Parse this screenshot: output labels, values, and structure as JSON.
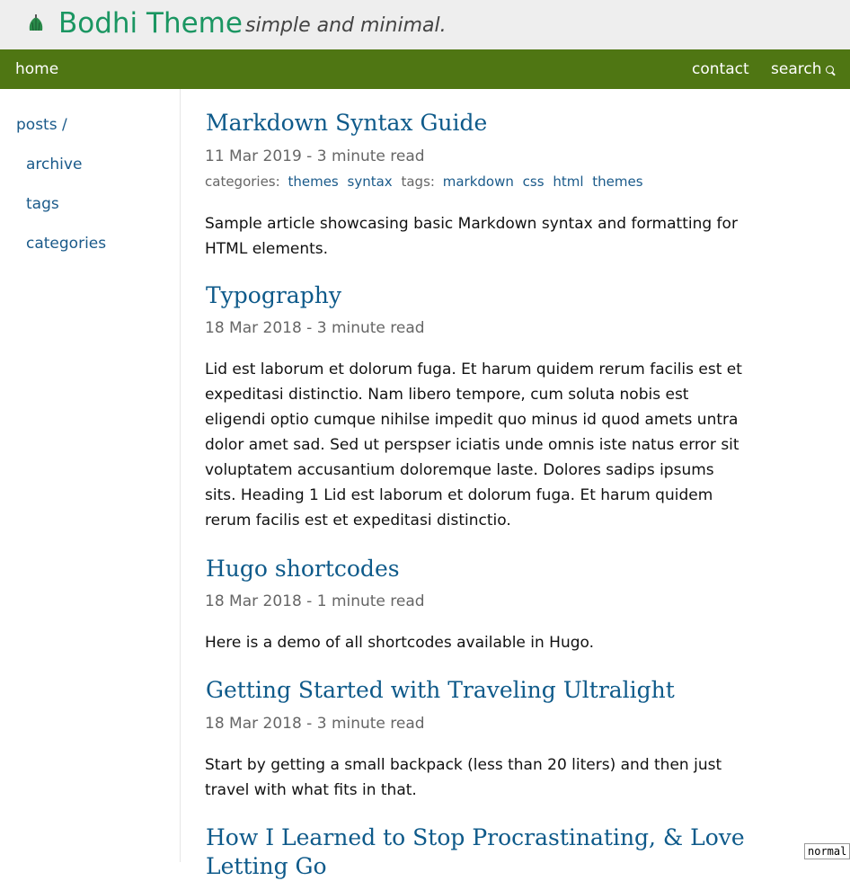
{
  "header": {
    "title": "Bodhi Theme",
    "tagline": "simple and minimal.",
    "logo_icon": "leaf-icon",
    "title_color": "#1b9662"
  },
  "nav": {
    "home": "home",
    "contact": "contact",
    "search": "search",
    "bar_color": "#4f7613"
  },
  "sidebar": {
    "posts": "posts /",
    "archive": "archive",
    "tags": "tags",
    "categories": "categories"
  },
  "posts": [
    {
      "title": "Markdown Syntax Guide",
      "meta": "11 Mar 2019 - 3 minute read",
      "categories_label": "categories:",
      "categories": [
        "themes",
        "syntax"
      ],
      "tags_label": "tags:",
      "tags": [
        "markdown",
        "css",
        "html",
        "themes"
      ],
      "summary": "Sample article showcasing basic Markdown syntax and formatting for HTML elements."
    },
    {
      "title": "Typography",
      "meta": "18 Mar 2018 - 3 minute read",
      "summary": "Lid est laborum et dolorum fuga. Et harum quidem rerum facilis est et expeditasi distinctio. Nam libero tempore, cum soluta nobis est eligendi optio cumque nihilse impedit quo minus id quod amets untra dolor amet sad. Sed ut perspser iciatis unde omnis iste natus error sit voluptatem accusantium doloremque laste. Dolores sadips ipsums sits. Heading 1 Lid est laborum et dolorum fuga. Et harum quidem rerum facilis est et expeditasi distinctio."
    },
    {
      "title": "Hugo shortcodes",
      "meta": "18 Mar 2018 - 1 minute read",
      "summary": "Here is a demo of all shortcodes available in Hugo."
    },
    {
      "title": "Getting Started with Traveling Ultralight",
      "meta": "18 Mar 2018 - 3 minute read",
      "summary": "Start by getting a small backpack (less than 20 liters) and then just travel with what fits in that."
    },
    {
      "title": "How I Learned to Stop Procrastinating, & Love Letting Go"
    }
  ],
  "badge": "normal"
}
